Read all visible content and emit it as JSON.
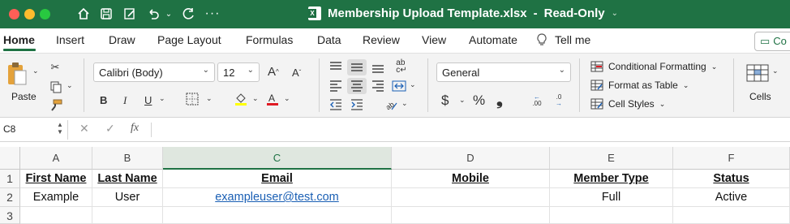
{
  "window": {
    "title": "Membership Upload Template.xlsx",
    "mode": "Read-Only",
    "separator": "-"
  },
  "tabs": [
    "Home",
    "Insert",
    "Draw",
    "Page Layout",
    "Formulas",
    "Data",
    "Review",
    "View",
    "Automate"
  ],
  "tell_me": "Tell me",
  "comments_label": "Co",
  "ribbon": {
    "paste_label": "Paste",
    "font_name": "Calibri (Body)",
    "font_size": "12",
    "grow_font": "A",
    "shrink_font": "A",
    "bold": "B",
    "italic": "I",
    "underline": "U",
    "number_format": "General",
    "currency": "$",
    "percent": "%",
    "comma": "❟",
    "inc_decimal": ".00",
    "dec_decimal": ".0",
    "conditional_formatting": "Conditional Formatting",
    "format_as_table": "Format as Table",
    "cell_styles": "Cell Styles",
    "cells_label": "Cells"
  },
  "formula_bar": {
    "name_box": "C8",
    "fx": "fx"
  },
  "columns": [
    "A",
    "B",
    "C",
    "D",
    "E",
    "F"
  ],
  "rows": [
    {
      "num": "1",
      "cells": [
        "First Name",
        "Last Name",
        "Email",
        "Mobile",
        "Member Type",
        "Status"
      ]
    },
    {
      "num": "2",
      "cells": [
        "Example",
        "User",
        "exampleuser@test.com",
        "",
        "Full",
        "Active"
      ]
    },
    {
      "num": "3",
      "cells": [
        "",
        "",
        "",
        "",
        "",
        ""
      ]
    }
  ],
  "colors": {
    "excel_green": "#1f7244",
    "link_blue": "#1a5fb4"
  }
}
